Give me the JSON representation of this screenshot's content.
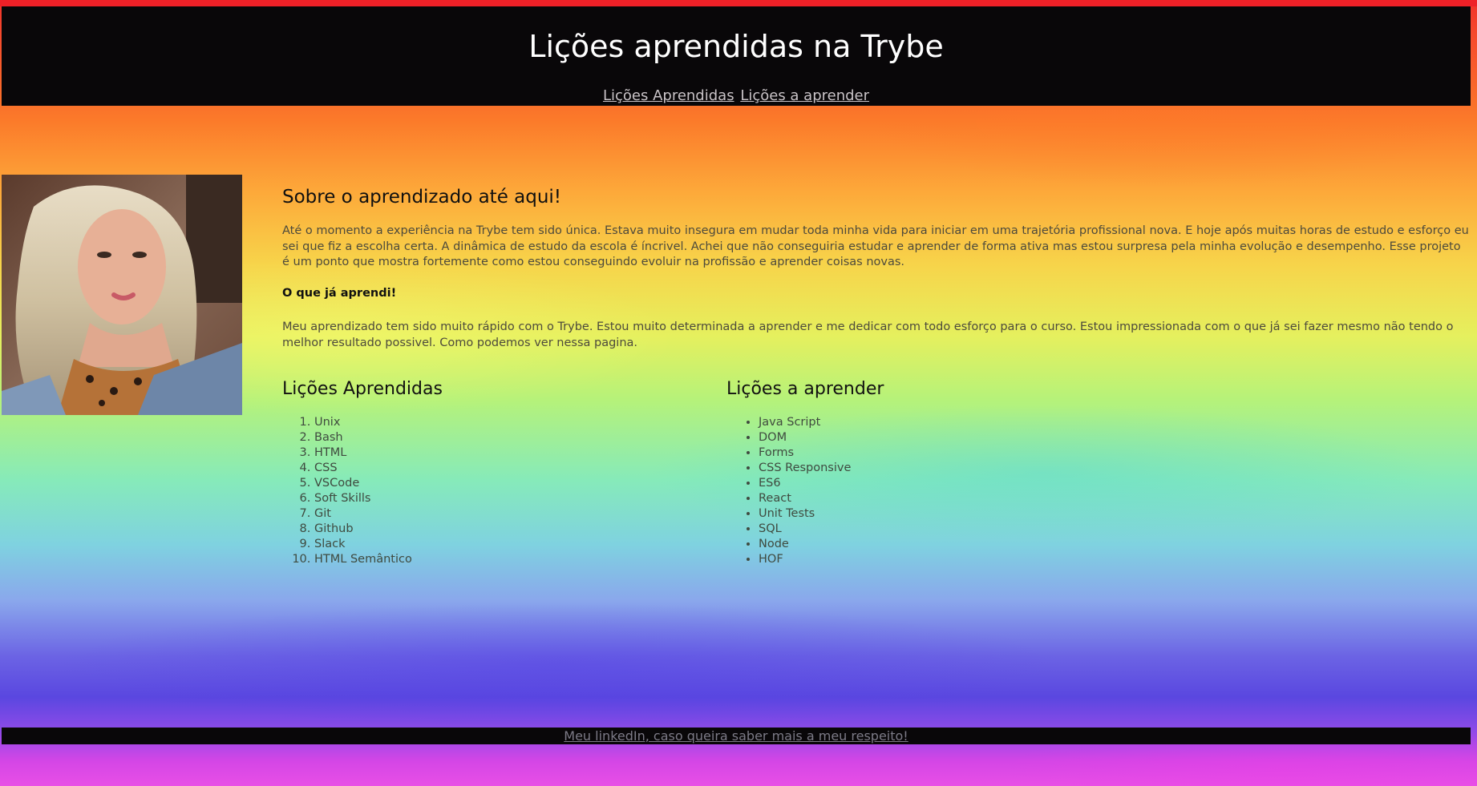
{
  "header": {
    "title": "Lições aprendidas na Trybe",
    "nav": {
      "learned_link": "Lições Aprendidas",
      "to_learn_link": "Lições a aprender"
    }
  },
  "about": {
    "title": "Sobre o aprendizado até aqui!",
    "paragraph1": "Até o momento a experiência na Trybe tem sido única. Estava muito insegura em mudar toda minha vida para iniciar em uma trajetória profissional nova. E hoje após muitas horas de estudo e esforço eu sei que fiz a escolha certa. A dinâmica de estudo da escola é íncrivel. Achei que não conseguiria estudar e aprender de forma ativa mas estou surpresa pela minha evolução e desempenho. Esse projeto é um ponto que mostra fortemente como estou conseguindo evoluir na profissão e aprender coisas novas.",
    "learned_heading": "O que já aprendi!",
    "paragraph2": "Meu aprendizado tem sido muito rápido com o Trybe. Estou muito determinada a aprender e me dedicar com todo esforço para o curso. Estou impressionada com o que já sei fazer mesmo não tendo o melhor resultado possivel. Como podemos ver nessa pagina."
  },
  "learned": {
    "title": "Lições Aprendidas",
    "items": [
      "Unix",
      "Bash",
      "HTML",
      "CSS",
      "VSCode",
      "Soft Skills",
      "Git",
      "Github",
      "Slack",
      "HTML Semântico"
    ]
  },
  "to_learn": {
    "title": "Lições a aprender",
    "items": [
      "Java Script",
      "DOM",
      "Forms",
      "CSS Responsive",
      "ES6",
      "React",
      "Unit Tests",
      "SQL",
      "Node",
      "HOF"
    ]
  },
  "footer": {
    "link": "Meu linkedIn, caso queira saber mais a meu respeito!"
  },
  "colors": {
    "header_bg": "#090709",
    "accent_top": "#ee2027",
    "nav_link": "#c9c3c7",
    "footer_link": "#7c7a86"
  }
}
